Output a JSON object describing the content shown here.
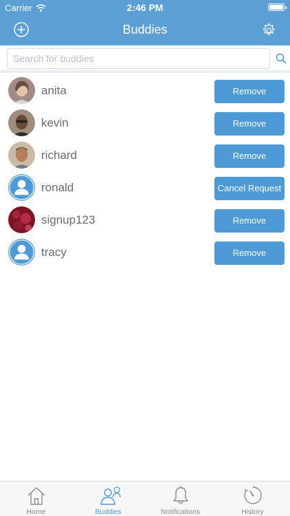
{
  "status_bar": {
    "carrier": "Carrier",
    "time": "2:46 PM"
  },
  "nav": {
    "title": "Buddies"
  },
  "search": {
    "placeholder": "Search for buddies",
    "value": ""
  },
  "buddies": [
    {
      "name": "anita",
      "action": "Remove",
      "avatar": "photo"
    },
    {
      "name": "kevin",
      "action": "Remove",
      "avatar": "photo"
    },
    {
      "name": "richard",
      "action": "Remove",
      "avatar": "photo"
    },
    {
      "name": "ronald",
      "action": "Cancel Request",
      "avatar": "default-person"
    },
    {
      "name": "signup123",
      "action": "Remove",
      "avatar": "photo"
    },
    {
      "name": "tracy",
      "action": "Remove",
      "avatar": "default-person"
    }
  ],
  "tabs": [
    {
      "label": "Home",
      "icon": "house-icon"
    },
    {
      "label": "Buddies",
      "icon": "buddies-icon",
      "active": true
    },
    {
      "label": "Notifications",
      "icon": "bell-icon"
    },
    {
      "label": "History",
      "icon": "clock-icon"
    }
  ],
  "colors": {
    "accent": "#5b9fd5",
    "button": "#4e9ad7",
    "tab_active": "#4e9ad7",
    "tab_inactive": "#8a8a8a"
  }
}
